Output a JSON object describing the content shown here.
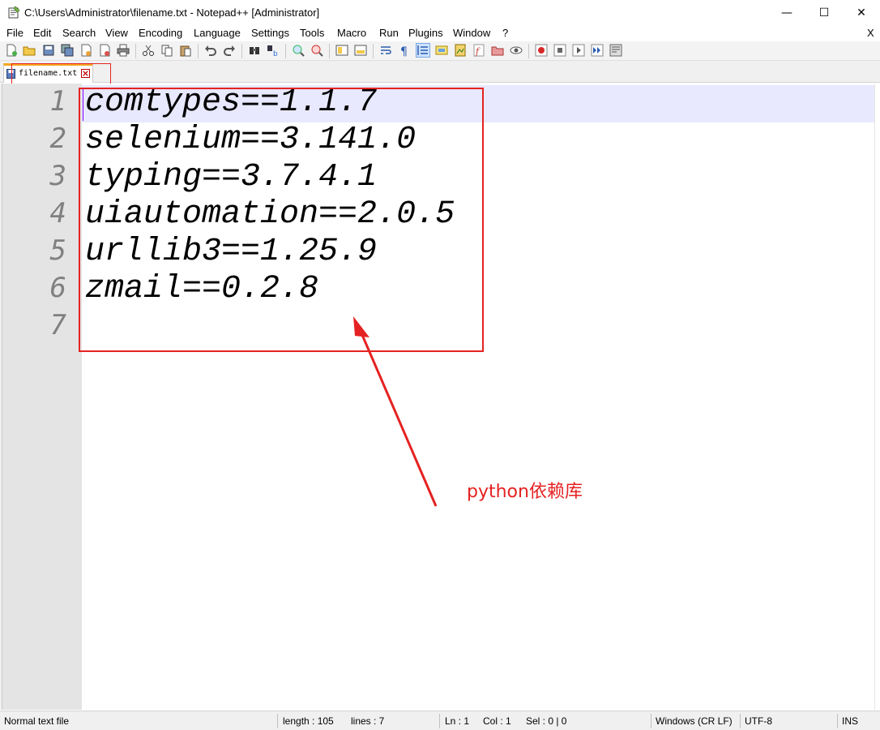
{
  "window": {
    "title": "C:\\Users\\Administrator\\filename.txt - Notepad++ [Administrator]",
    "minimize_glyph": "—",
    "maximize_glyph": "☐",
    "close_glyph": "✕"
  },
  "menu": {
    "items": [
      "File",
      "Edit",
      "Search",
      "View",
      "Encoding",
      "Language",
      "Settings",
      "Tools",
      "Macro",
      "Run",
      "Plugins",
      "Window",
      "?"
    ],
    "close_doc": "X"
  },
  "toolbar": {
    "icons": [
      "new-file-icon",
      "open-file-icon",
      "save-icon",
      "save-all-icon",
      "close-icon",
      "close-all-icon",
      "print-icon",
      "cut-icon",
      "copy-icon",
      "paste-icon",
      "undo-icon",
      "redo-icon",
      "find-icon",
      "replace-icon",
      "zoom-in-icon",
      "zoom-out-icon",
      "sync-vertical-icon",
      "sync-horizontal-icon",
      "word-wrap-icon",
      "show-all-characters-icon",
      "indent-guide-icon",
      "user-defined-language-icon",
      "doc-map-icon",
      "function-list-icon",
      "folder-as-workspace-icon",
      "monitoring-icon",
      "record-macro-icon",
      "stop-macro-icon",
      "play-macro-icon",
      "run-macro-multiple-icon",
      "save-macro-icon"
    ]
  },
  "tabs": [
    {
      "label": "filename.txt",
      "active": true
    }
  ],
  "editor": {
    "lines": [
      {
        "number": "1",
        "text": "comtypes==1.1.7"
      },
      {
        "number": "2",
        "text": "selenium==3.141.0"
      },
      {
        "number": "3",
        "text": "typing==3.7.4.1"
      },
      {
        "number": "4",
        "text": "uiautomation==2.0.5"
      },
      {
        "number": "5",
        "text": "urllib3==1.25.9"
      },
      {
        "number": "6",
        "text": "zmail==0.2.8"
      },
      {
        "number": "7",
        "text": ""
      }
    ]
  },
  "annotation": {
    "text": "python依赖库",
    "color": "#e52222"
  },
  "status": {
    "file_type": "Normal text file",
    "length": "length : 105",
    "lines": "lines : 7",
    "ln": "Ln : 1",
    "col": "Col : 1",
    "sel": "Sel : 0 | 0",
    "eol": "Windows (CR LF)",
    "encoding": "UTF-8",
    "mode": "INS"
  },
  "colors": {
    "current_line": "#e8e8ff",
    "gutter": "#e4e4e4",
    "tab_accent": "#f5a623",
    "annotation_red": "#e52222"
  }
}
